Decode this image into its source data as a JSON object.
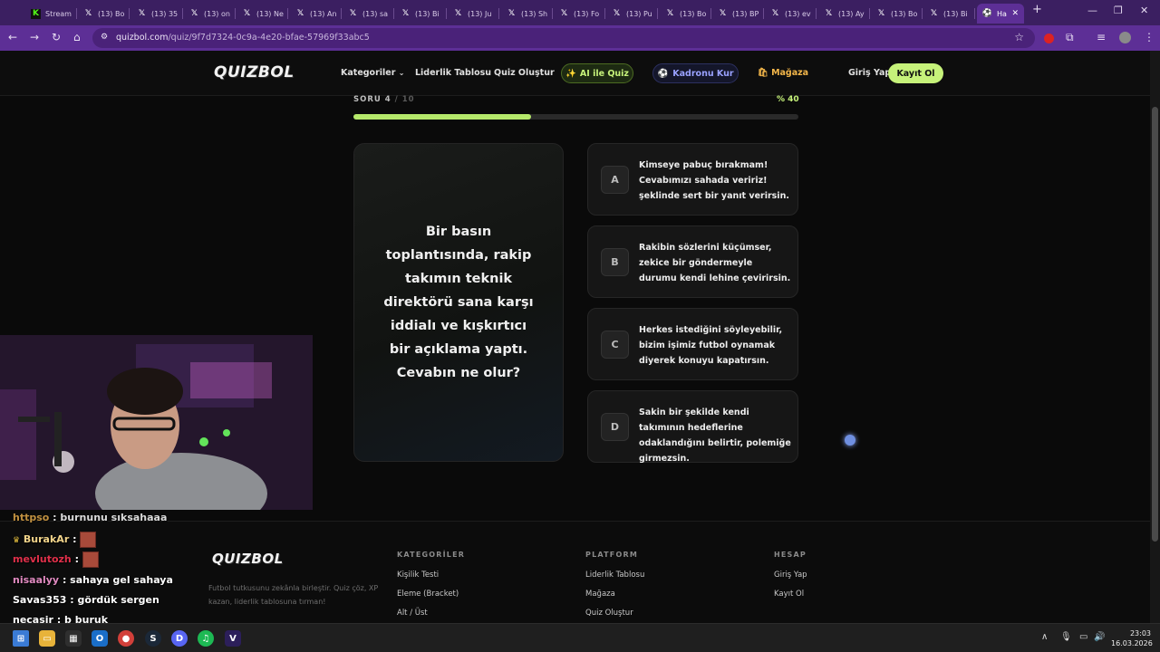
{
  "browser": {
    "tabs": [
      {
        "label": "Stream",
        "icon": "kick-icon"
      },
      {
        "label": "(13) Bo",
        "icon": "x-icon"
      },
      {
        "label": "(13) 35",
        "icon": "x-icon"
      },
      {
        "label": "(13) on",
        "icon": "x-icon"
      },
      {
        "label": "(13) Ne",
        "icon": "x-icon"
      },
      {
        "label": "(13) An",
        "icon": "x-icon"
      },
      {
        "label": "(13) sa",
        "icon": "x-icon"
      },
      {
        "label": "(13) Bi",
        "icon": "x-icon"
      },
      {
        "label": "(13) Ju",
        "icon": "x-icon"
      },
      {
        "label": "(13) Sh",
        "icon": "x-icon"
      },
      {
        "label": "(13) Fo",
        "icon": "x-icon"
      },
      {
        "label": "(13) Pu",
        "icon": "x-icon"
      },
      {
        "label": "(13) Bo",
        "icon": "x-icon"
      },
      {
        "label": "(13) BP",
        "icon": "x-icon"
      },
      {
        "label": "(13) ev",
        "icon": "x-icon"
      },
      {
        "label": "(13) Ay",
        "icon": "x-icon"
      },
      {
        "label": "(13) Bo",
        "icon": "x-icon"
      },
      {
        "label": "(13) Bi",
        "icon": "x-icon"
      }
    ],
    "active_tab": {
      "label": "Ha",
      "icon": "quizbol-icon"
    },
    "url_host": "quizbol.com",
    "url_path": "/quiz/9f7d7324-0c9a-4e20-bfae-57969f33abc5"
  },
  "site": {
    "logo": "QUIZBOL",
    "nav": {
      "categories": "Kategoriler",
      "leaderboard": "Liderlik Tablosu",
      "create_quiz": "Quiz Oluştur",
      "ai_quiz": "AI ile Quiz",
      "squad": "Kadronu Kur",
      "store": "Mağaza",
      "login": "Giriş Yap",
      "register": "Kayıt Ol"
    },
    "colors": {
      "accent": "#c6f27a",
      "background": "#0a0a0a"
    }
  },
  "quiz": {
    "question_label": "SORU 4",
    "question_total": "/ 10",
    "progress_text": "% 40",
    "progress": 0.4,
    "question": "Bir basın toplantısında, rakip takımın teknik direktörü sana karşı iddialı ve kışkırtıcı bir açıklama yaptı. Cevabın ne olur?",
    "options": [
      {
        "letter": "A",
        "text": "Kimseye pabuç bırakmam! Cevabımızı sahada veririz! şeklinde sert bir yanıt verirsin."
      },
      {
        "letter": "B",
        "text": "Rakibin sözlerini küçümser, zekice bir göndermeyle durumu kendi lehine çevirirsin."
      },
      {
        "letter": "C",
        "text": "Herkes istediğini söyleyebilir, bizim işimiz futbol oynamak diyerek konuyu kapatırsın."
      },
      {
        "letter": "D",
        "text": "Sakin bir şekilde kendi takımının hedeflerine odaklandığını belirtir, polemiğe girmezsin."
      }
    ]
  },
  "footer": {
    "logo": "QUIZBOL",
    "tagline": "Futbol tutkusunu zekânla birleştir. Quiz çöz, XP kazan, liderlik tablosuna tırman!",
    "columns": [
      {
        "title": "KATEGORİLER",
        "links": [
          "Kişilik Testi",
          "Eleme (Bracket)",
          "Alt / Üst"
        ]
      },
      {
        "title": "PLATFORM",
        "links": [
          "Liderlik Tablosu",
          "Mağaza",
          "Quiz Oluştur"
        ]
      },
      {
        "title": "HESAP",
        "links": [
          "Giriş Yap",
          "Kayıt Ol"
        ]
      }
    ]
  },
  "chat": [
    {
      "user": "httpso",
      "message": ": burnunu sıksahaaa",
      "color": "#e0a84a"
    },
    {
      "user": "BurakAr",
      "message": ":",
      "color": "#f2d48a"
    },
    {
      "user": "mevlutozh",
      "message": ":",
      "color": "#e0304a"
    },
    {
      "user": "nisaalyy",
      "message": ": sahaya gel sahaya",
      "color": "#e08ac0"
    },
    {
      "user": "Savas353",
      "message": ": gördük sergen",
      "color": "#ffffff"
    },
    {
      "user": "necasir",
      "message": ": b buruk",
      "color": "#ffffff"
    }
  ],
  "taskbar": {
    "time": "23:03",
    "date": "16.03.2026"
  }
}
